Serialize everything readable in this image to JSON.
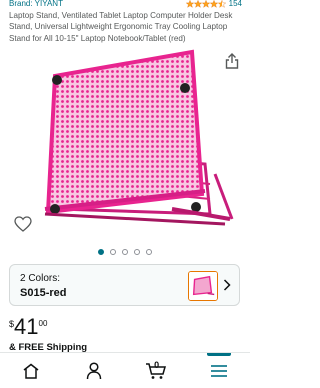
{
  "header": {
    "brand": "Brand: YIYANT",
    "rating_stars": 4.5,
    "rating_count": "154"
  },
  "product": {
    "title": "Laptop Stand, Ventilated Tablet Laptop Computer Holder Desk Stand, Universal Lightweight Ergonomic Tray Cooling Laptop Stand for All 10-15\" Laptop Notebook/Tablet (red)",
    "image_icon": "laptop-stand-illustration",
    "image_color": "#e8248f"
  },
  "carousel": {
    "total": 5,
    "active_index": 0
  },
  "variant": {
    "count_label": "2 Colors:",
    "selected": "S015-red"
  },
  "price": {
    "symbol": "$",
    "whole": "41",
    "fraction": "00"
  },
  "shipping": {
    "text": "& FREE Shipping"
  },
  "nav": {
    "items": [
      {
        "icon": "home-icon"
      },
      {
        "icon": "account-icon"
      },
      {
        "icon": "cart-icon",
        "count": "0"
      },
      {
        "icon": "menu-icon",
        "active": true
      }
    ]
  },
  "colors": {
    "link": "#007185",
    "star": "#ffa41c",
    "product": "#e8248f"
  }
}
